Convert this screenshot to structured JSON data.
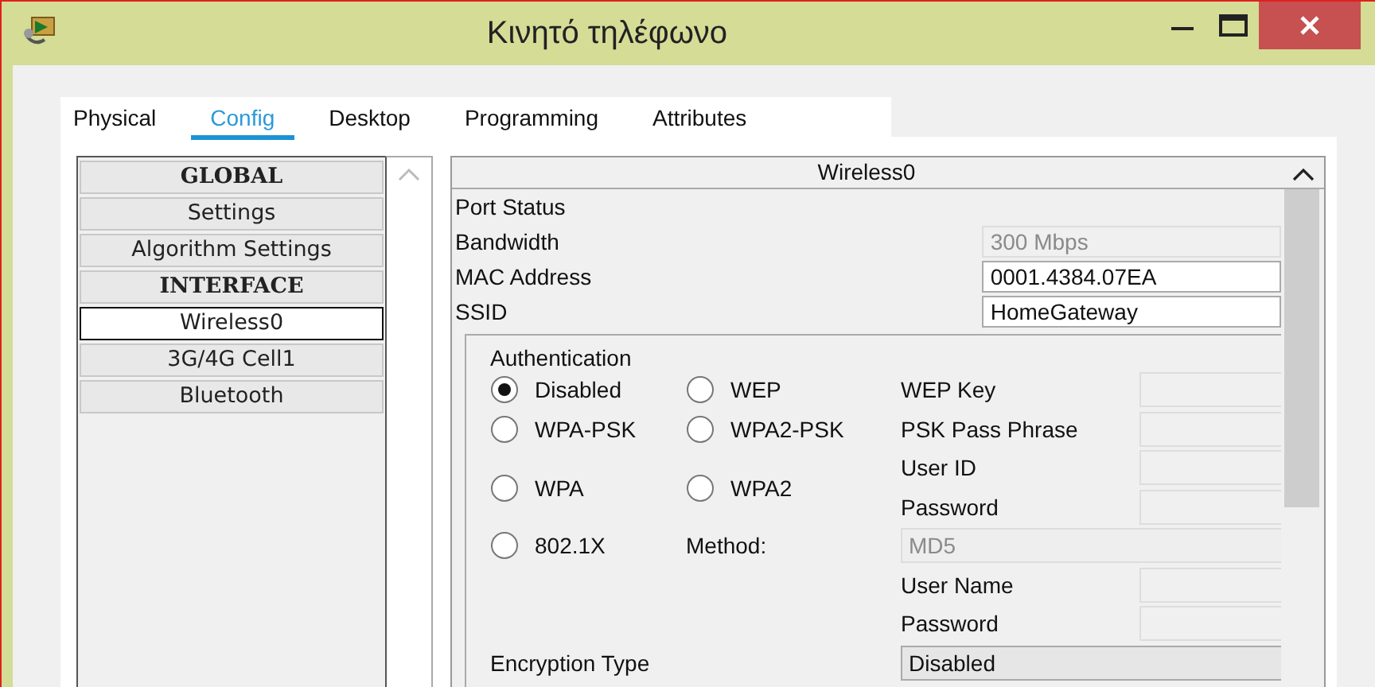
{
  "window": {
    "title": "Κινητό τηλέφωνο"
  },
  "tabs": [
    {
      "label": "Physical",
      "selected": false
    },
    {
      "label": "Config",
      "selected": true
    },
    {
      "label": "Desktop",
      "selected": false
    },
    {
      "label": "Programming",
      "selected": false
    },
    {
      "label": "Attributes",
      "selected": false
    }
  ],
  "sidebar": {
    "items": [
      {
        "label": "GLOBAL",
        "kind": "heading",
        "selected": false
      },
      {
        "label": "Settings",
        "kind": "item",
        "selected": false
      },
      {
        "label": "Algorithm Settings",
        "kind": "item",
        "selected": false
      },
      {
        "label": "INTERFACE",
        "kind": "heading",
        "selected": false
      },
      {
        "label": "Wireless0",
        "kind": "item",
        "selected": true
      },
      {
        "label": "3G/4G Cell1",
        "kind": "item",
        "selected": false
      },
      {
        "label": "Bluetooth",
        "kind": "item",
        "selected": false
      }
    ]
  },
  "panel": {
    "title": "Wireless0",
    "rows": [
      {
        "label": "Port Status"
      },
      {
        "label": "Bandwidth",
        "value": "300 Mbps",
        "disabled": true
      },
      {
        "label": "MAC Address",
        "value": "0001.4384.07EA",
        "disabled": false
      },
      {
        "label": "SSID",
        "value": "HomeGateway",
        "disabled": false
      }
    ]
  },
  "authentication": {
    "title": "Authentication",
    "options": [
      {
        "label": "Disabled",
        "selected": true
      },
      {
        "label": "WEP",
        "selected": false
      },
      {
        "label": "WPA-PSK",
        "selected": false
      },
      {
        "label": "WPA2-PSK",
        "selected": false
      },
      {
        "label": "WPA",
        "selected": false
      },
      {
        "label": "WPA2",
        "selected": false
      },
      {
        "label": "802.1X",
        "selected": false
      }
    ],
    "fields": [
      {
        "label": "WEP Key"
      },
      {
        "label": "PSK Pass Phrase"
      },
      {
        "label": "User ID"
      },
      {
        "label": "Password"
      },
      {
        "label": "User Name"
      },
      {
        "label": "Password"
      }
    ],
    "method": {
      "label": "Method:",
      "value": "MD5",
      "disabled": true
    }
  },
  "encryption": {
    "label": "Encryption Type",
    "value": "Disabled"
  }
}
